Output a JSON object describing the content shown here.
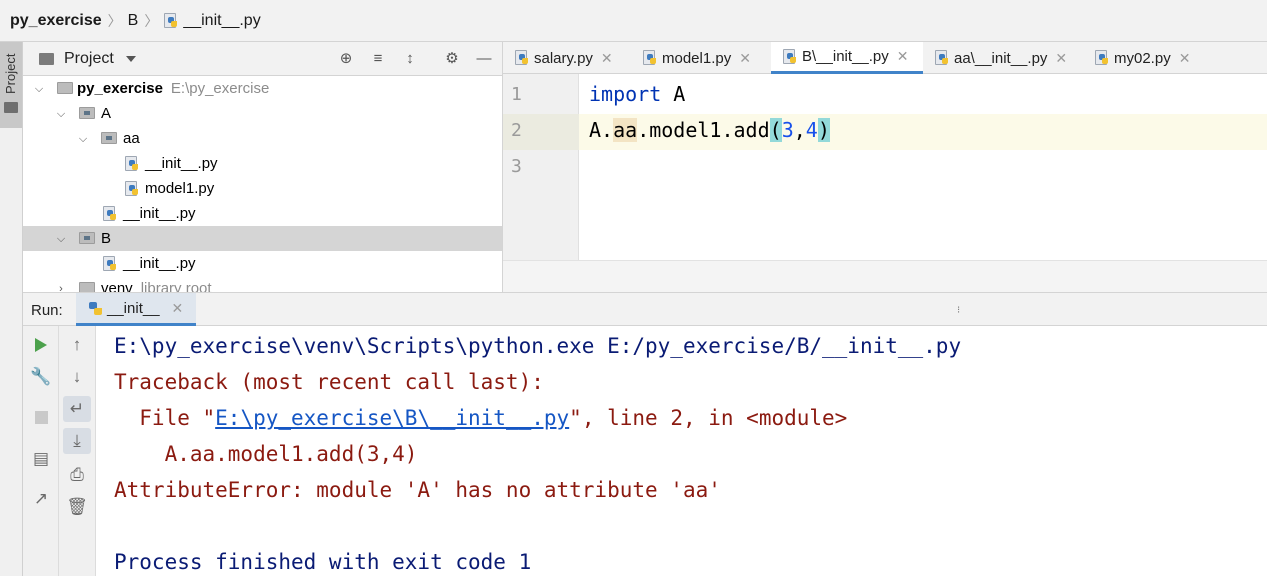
{
  "breadcrumb": {
    "project": "py_exercise",
    "folder": "B",
    "file": "__init__.py"
  },
  "side_strip": {
    "label": "Project"
  },
  "project_panel": {
    "title": "Project",
    "tree": [
      {
        "name": "py_exercise",
        "path": "E:\\py_exercise",
        "type": "folder",
        "expanded": true,
        "bold": true
      },
      {
        "name": "A",
        "type": "package",
        "expanded": true
      },
      {
        "name": "aa",
        "type": "package",
        "expanded": true
      },
      {
        "name": "__init__.py",
        "type": "python-file"
      },
      {
        "name": "model1.py",
        "type": "python-file"
      },
      {
        "name": "__init__.py",
        "type": "python-file"
      },
      {
        "name": "B",
        "type": "package",
        "expanded": true,
        "selected": true
      },
      {
        "name": "__init__.py",
        "type": "python-file"
      },
      {
        "name": "venv",
        "path": "library root",
        "type": "folder",
        "expanded": false
      }
    ]
  },
  "editor": {
    "tabs": [
      {
        "label": "salary.py"
      },
      {
        "label": "model1.py"
      },
      {
        "label": "B\\__init__.py",
        "active": true
      },
      {
        "label": "aa\\__init__.py"
      },
      {
        "label": "my02.py"
      }
    ],
    "line_numbers": [
      "1",
      "2",
      "3"
    ],
    "code": {
      "line1_kw": "import",
      "line1_rest": " A",
      "line2_prefix": "A.",
      "line2_aa": "aa",
      "line2_mid": ".model1.add",
      "line2_open": "(",
      "line2_arg1": "3",
      "line2_comma": ",",
      "line2_arg2": "4",
      "line2_close": ")"
    }
  },
  "run": {
    "label": "Run:",
    "tab": "__init__",
    "output": {
      "cmd": "E:\\py_exercise\\venv\\Scripts\\python.exe E:/py_exercise/B/__init__.py",
      "traceback": "Traceback (most recent call last):",
      "file_prefix": "  File \"",
      "file_link": "E:\\py_exercise\\B\\__init__.py",
      "file_suffix": "\", line 2, in <module>",
      "code": "    A.aa.model1.add(3,4)",
      "error": "AttributeError: module 'A' has no attribute 'aa'",
      "finished": "Process finished with exit code 1"
    }
  },
  "colors": {
    "accent": "#4083c9",
    "keyword": "#0033b3",
    "number": "#1750eb",
    "console_error": "#8b1a10",
    "console_normal": "#0a1b74",
    "selection": "#d5d5d5"
  }
}
